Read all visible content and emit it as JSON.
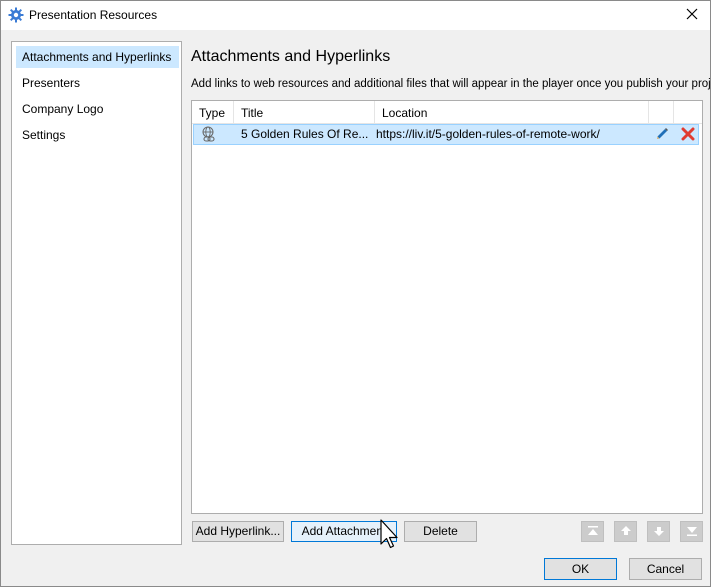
{
  "window": {
    "title": "Presentation Resources",
    "icons": {
      "app": "gear-icon",
      "close": "close-icon"
    }
  },
  "sidebar": {
    "items": [
      {
        "label": "Attachments and Hyperlinks",
        "selected": true
      },
      {
        "label": "Presenters",
        "selected": false
      },
      {
        "label": "Company Logo",
        "selected": false
      },
      {
        "label": "Settings",
        "selected": false
      }
    ]
  },
  "main": {
    "title": "Attachments and Hyperlinks",
    "description": "Add links to web resources and additional files that will appear in the player once you publish your project.",
    "table": {
      "columns": [
        "Type",
        "Title",
        "Location"
      ],
      "rows": [
        {
          "type_icon": "hyperlink-icon",
          "title": "5 Golden Rules Of Re...",
          "location": "https://liv.it/5-golden-rules-of-remote-work/",
          "edit_icon": "edit-pencil-icon",
          "delete_icon": "delete-x-icon"
        }
      ]
    }
  },
  "actions": {
    "add_hyperlink": "Add Hyperlink...",
    "add_attachment": "Add Attachment",
    "delete": "Delete",
    "move_icons": [
      "move-to-top-icon",
      "move-up-icon",
      "move-down-icon",
      "move-to-bottom-icon"
    ]
  },
  "footer": {
    "ok": "OK",
    "cancel": "Cancel"
  },
  "colors": {
    "selection": "#cce8ff",
    "accent": "#0078d7",
    "gear": "#3a7bd5",
    "delete": "#e03c31",
    "pencil": "#1f6fb8"
  }
}
